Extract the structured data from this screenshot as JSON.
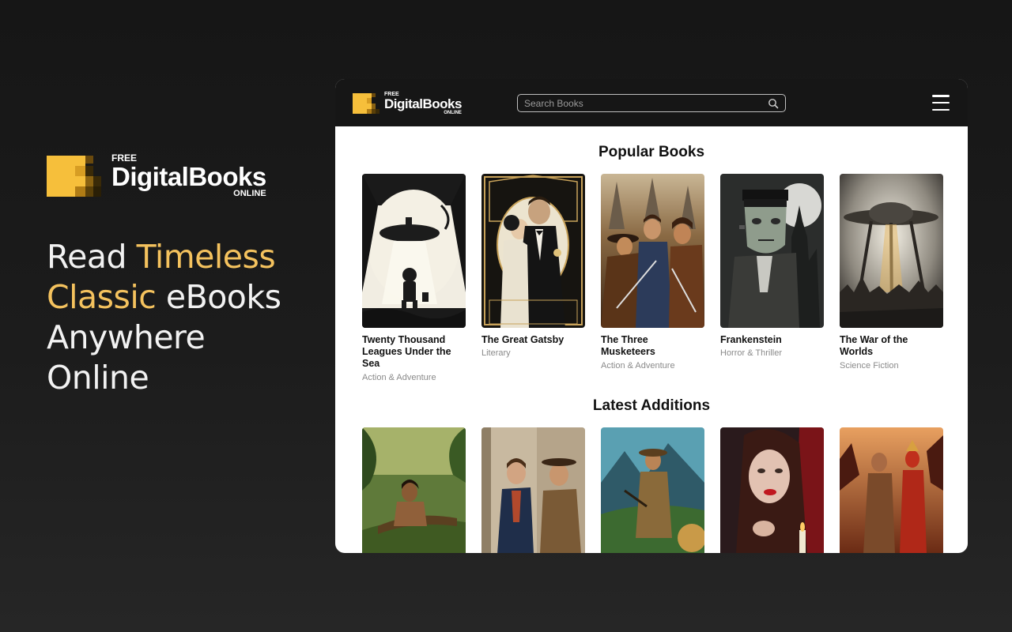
{
  "brand": {
    "free": "FREE",
    "name": "DigitalBooks",
    "online": "ONLINE",
    "accent_color": "#f4c25e"
  },
  "hero": {
    "line1_plain": "Read ",
    "line1_accent": "Timeless",
    "line2_accent": "Classic",
    "line2_plain": " eBooks",
    "line3": "Anywhere",
    "line4": "Online"
  },
  "navbar": {
    "search_placeholder": "Search Books",
    "search_icon": "search-icon",
    "menu_icon": "hamburger-menu-icon"
  },
  "popular": {
    "title": "Popular Books",
    "books": [
      {
        "title": "Twenty Thousand Leagues Under the Sea",
        "genre": "Action & Adventure"
      },
      {
        "title": "The Great Gatsby",
        "genre": "Literary"
      },
      {
        "title": "The Three Musketeers",
        "genre": "Action & Adventure"
      },
      {
        "title": "Frankenstein",
        "genre": "Horror & Thriller"
      },
      {
        "title": "The War of the Worlds",
        "genre": "Science Fiction"
      }
    ]
  },
  "latest": {
    "title": "Latest Additions",
    "books": [
      {
        "cover": "jungle-man-cover"
      },
      {
        "cover": "two-gentlemen-cover"
      },
      {
        "cover": "explorer-cover"
      },
      {
        "cover": "red-lips-woman-cover"
      },
      {
        "cover": "warriors-cover"
      }
    ]
  }
}
